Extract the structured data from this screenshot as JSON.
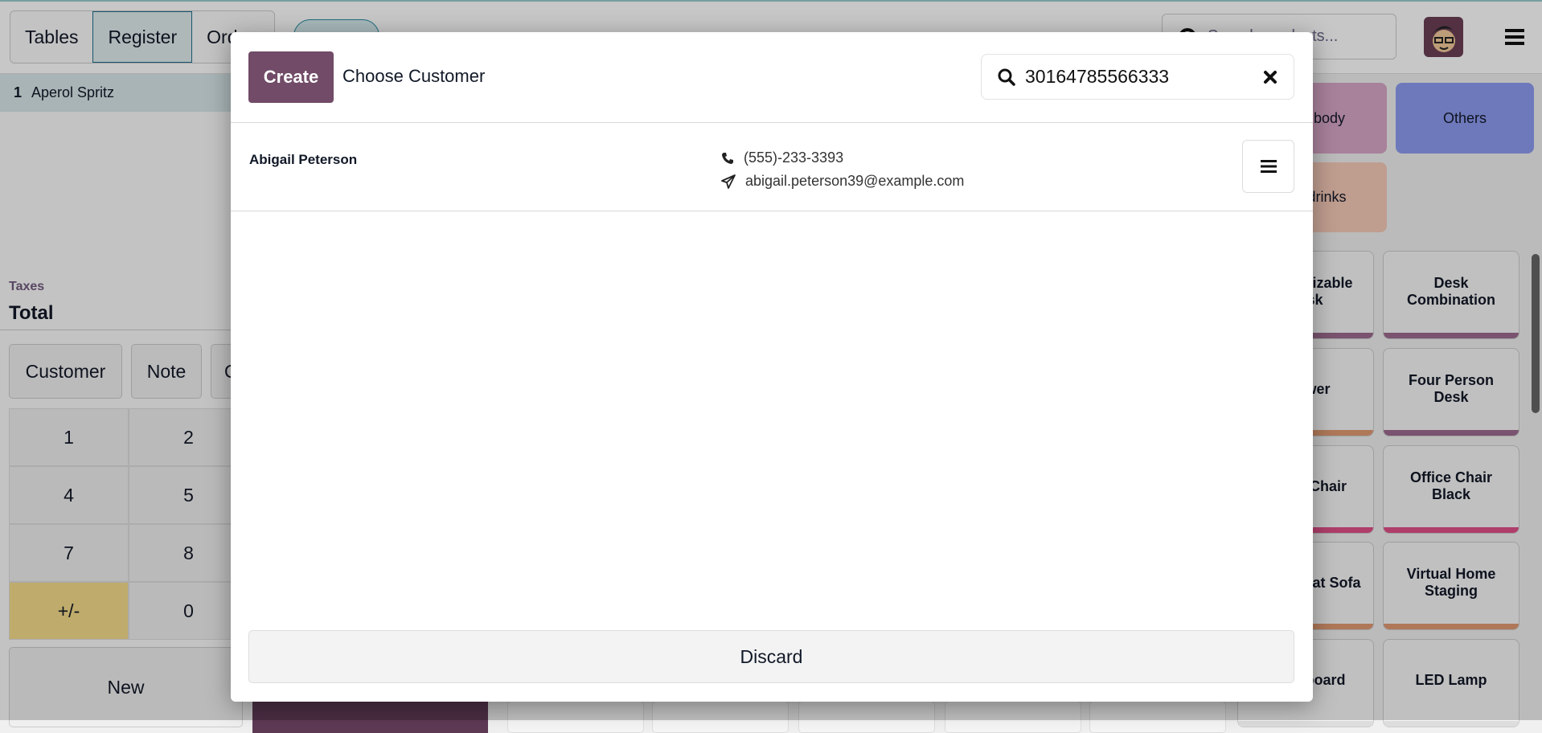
{
  "topbar": {
    "tabs": [
      "Tables",
      "Register",
      "Orders"
    ],
    "product_search_placeholder": "Search products..."
  },
  "order": {
    "lines": [
      {
        "qty": "1",
        "name": "Aperol Spritz"
      }
    ],
    "taxes_label": "Taxes",
    "total_label": "Total"
  },
  "actions": {
    "customer": "Customer",
    "note": "Note",
    "third": "Q"
  },
  "numpad": [
    "1",
    "2",
    "4",
    "5",
    "7",
    "8",
    "+/-",
    "0"
  ],
  "new_label": "New",
  "categories": [
    {
      "label": "Beer body",
      "color": "#d8a6c7"
    },
    {
      "label": "Others",
      "color": "#8e9bf0"
    },
    {
      "label": "Soft drinks",
      "color": "#f5c9b8"
    }
  ],
  "products": [
    {
      "name": "Customizable Desk",
      "color": "#9c6b8f"
    },
    {
      "name": "Desk Combination",
      "color": "#9c6b8f"
    },
    {
      "name": "Drawer",
      "color": "#e09a73"
    },
    {
      "name": "Four Person Desk",
      "color": "#9c6b8f"
    },
    {
      "name": "Office Chair",
      "color": "#e0508a"
    },
    {
      "name": "Office Chair Black",
      "color": "#e0508a"
    },
    {
      "name": "Three-Seat Sofa",
      "color": "#e09a73"
    },
    {
      "name": "Virtual Home Staging",
      "color": "#e09a73"
    },
    {
      "name": "Whiteboard",
      "color": "#ddd"
    },
    {
      "name": "LED Lamp",
      "color": "#ddd"
    }
  ],
  "modal": {
    "create_label": "Create",
    "title": "Choose Customer",
    "search_value": "30164785566333",
    "customers": [
      {
        "name": "Abigail Peterson",
        "phone": "(555)-233-3393",
        "email": "abigail.peterson39@example.com"
      }
    ],
    "discard_label": "Discard"
  },
  "colors": {
    "brand": "#714b67",
    "numpad_highlight": "#f5dc8a"
  }
}
